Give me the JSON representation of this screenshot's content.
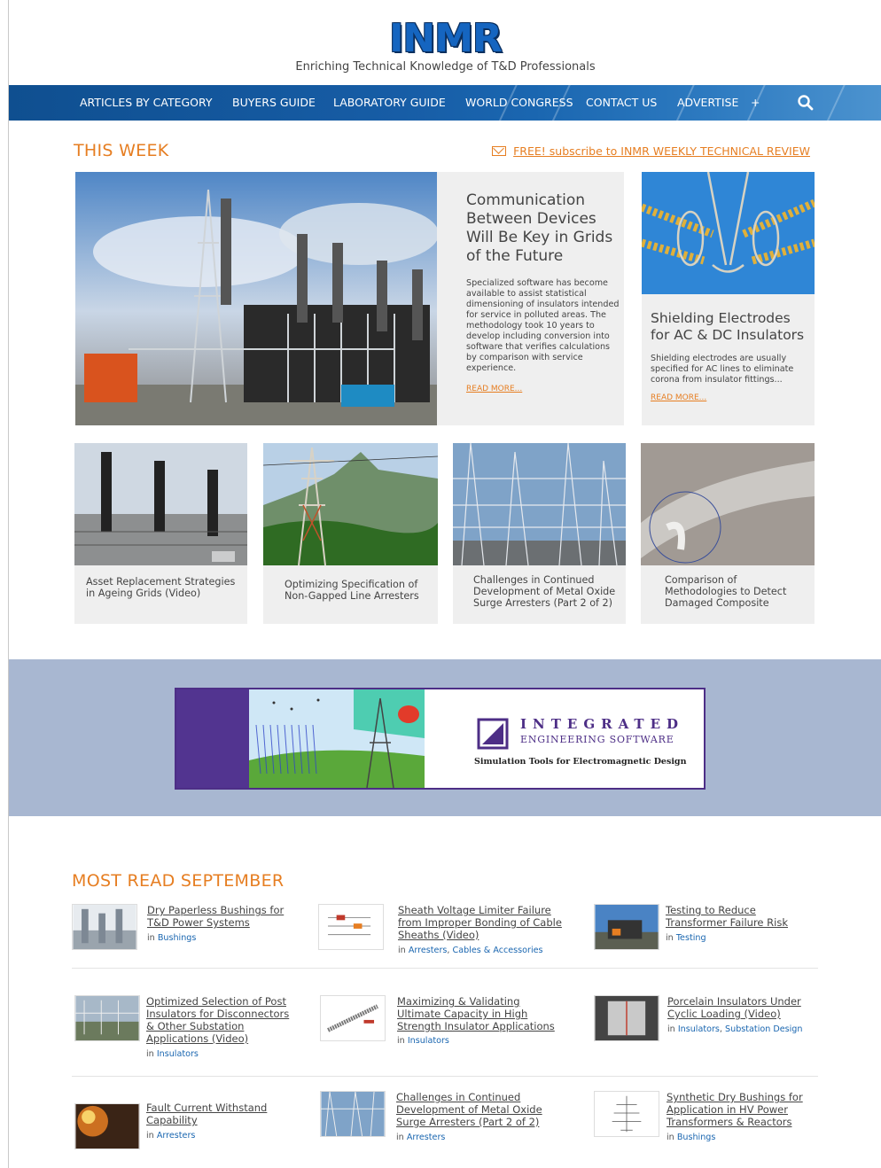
{
  "header": {
    "logo_text": "INMR",
    "tagline": "Enriching Technical Knowledge of T&D Professionals"
  },
  "nav": {
    "items": [
      "ARTICLES BY CATEGORY",
      "BUYERS GUIDE",
      "LABORATORY GUIDE",
      "WORLD CONGRESS",
      "CONTACT US",
      "ADVERTISE",
      "+"
    ],
    "search_icon": "search-icon"
  },
  "this_week": {
    "title": "THIS WEEK",
    "subscribe": "FREE! subscribe to INMR WEEKLY TECHNICAL REVIEW",
    "feature_main": {
      "title": "Communication Between Devices Will Be Key in Grids of the Future",
      "description": "Specialized software has become available to assist statistical dimensioning of insulators intended for service in polluted areas. The methodology took 10 years to develop including conversion into software that verifies calculations by comparison with service experience.",
      "read_more": "READ MORE..."
    },
    "feature_side": {
      "title": "Shielding Electrodes for AC & DC Insulators",
      "description": "Shielding electrodes are usually specified for AC lines to eliminate corona from insulator fittings...",
      "read_more": "READ MORE..."
    },
    "small": [
      "Asset Replacement Strategies in Ageing Grids (Video)",
      "Optimizing Specification of Non-Gapped Line Arresters",
      "Challenges in Continued Development of Metal Oxide Surge Arresters (Part 2 of 2)",
      "Comparison of Methodologies to Detect Damaged Composite"
    ]
  },
  "ad": {
    "brand_line1": "INTEGRATED",
    "brand_line2": "ENGINEERING SOFTWARE",
    "slogan": "Simulation Tools for Electromagnetic Design"
  },
  "most_read": {
    "title": "MOST READ SEPTEMBER",
    "prefix": "in",
    "items": [
      {
        "title": "Dry Paperless Bushings for T&D Power Systems",
        "cats": [
          "Bushings"
        ]
      },
      {
        "title": "Sheath Voltage Limiter Failure from Improper Bonding of Cable Sheaths (Video)",
        "cats": [
          "Arresters",
          "Cables & Accessories"
        ]
      },
      {
        "title": "Testing to Reduce Transformer Failure Risk",
        "cats": [
          "Testing"
        ]
      },
      {
        "title": "Optimized Selection of Post Insulators for Disconnectors & Other Substation Applications (Video)",
        "cats": [
          "Insulators"
        ]
      },
      {
        "title": "Maximizing & Validating Ultimate Capacity in High Strength Insulator Applications",
        "cats": [
          "Insulators"
        ]
      },
      {
        "title": "Porcelain Insulators Under Cyclic Loading (Video)",
        "cats": [
          "Insulators",
          "Substation Design"
        ]
      },
      {
        "title": "Fault Current Withstand Capability",
        "cats": [
          "Arresters"
        ]
      },
      {
        "title": "Challenges in Continued Development of Metal Oxide Surge Arresters (Part 2 of 2)",
        "cats": [
          "Arresters"
        ]
      },
      {
        "title": "Synthetic Dry Bushings for Application in HV Power Transformers & Reactors",
        "cats": [
          "Bushings"
        ]
      }
    ]
  }
}
